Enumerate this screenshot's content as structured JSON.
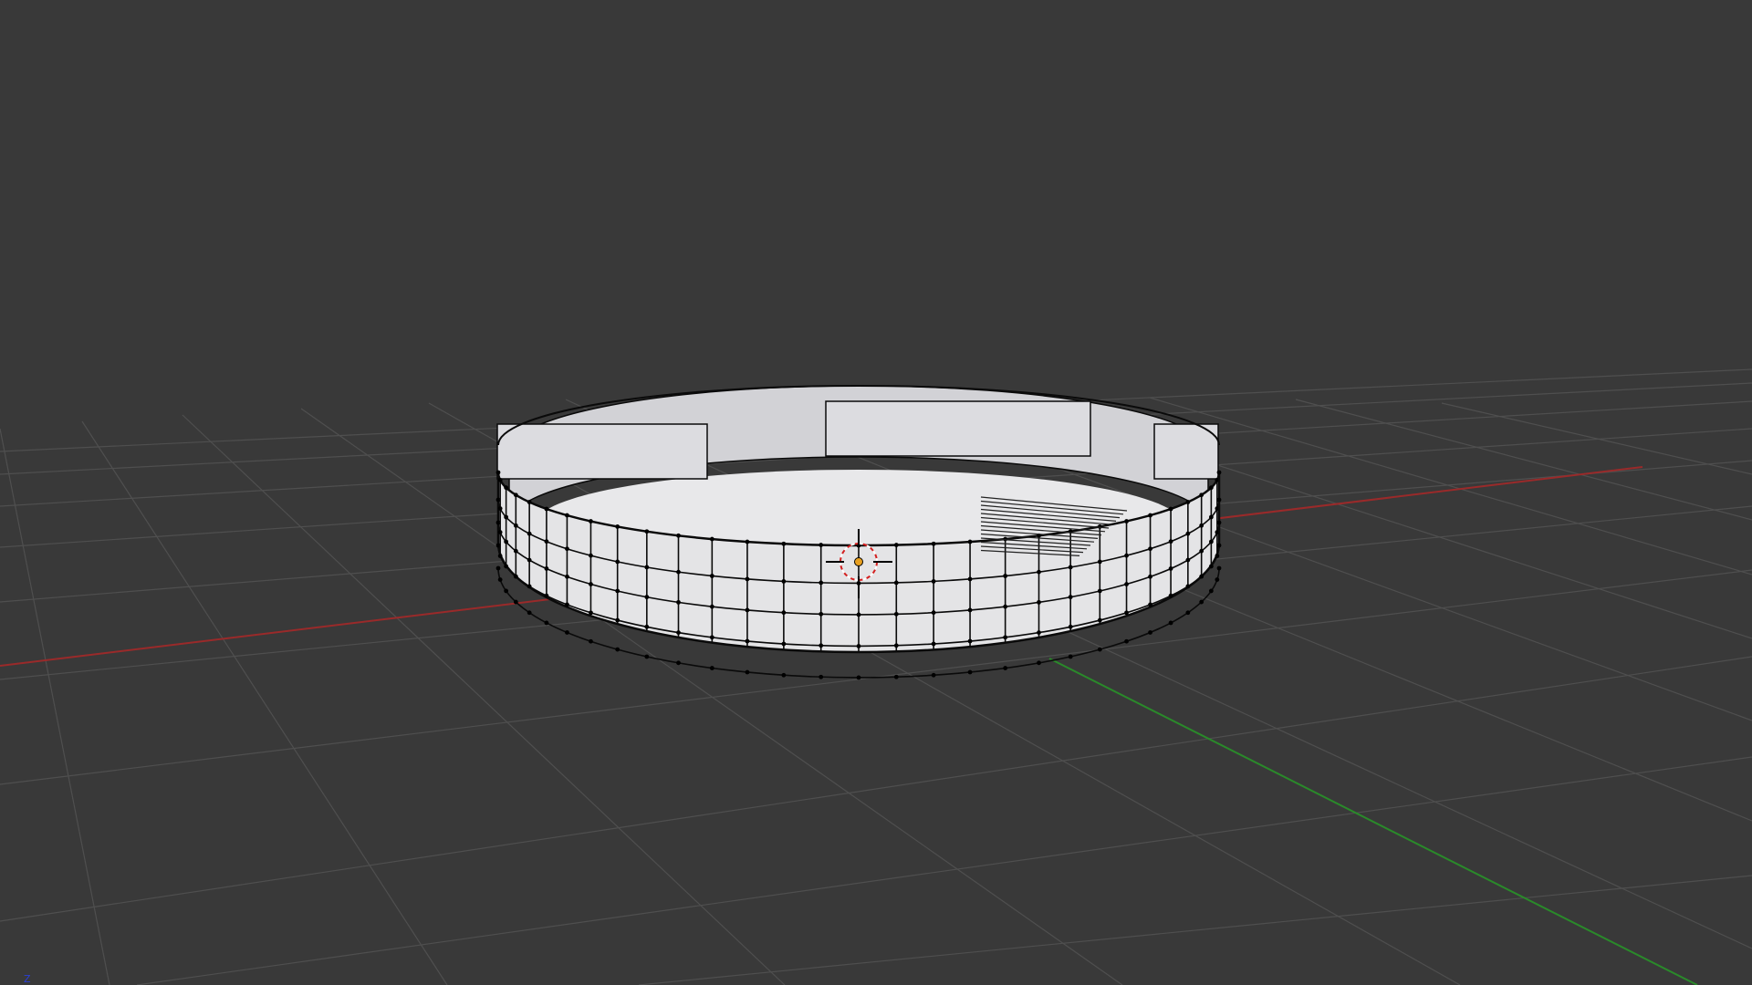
{
  "viewport": {
    "background": "#393939",
    "grid_color": "#4f4f4f",
    "x_axis_color": "#9a2a2a",
    "y_axis_color": "#2a8a2a",
    "mesh_face_color": "#e4e4e6",
    "mesh_edge_color": "#0a0a0a",
    "cursor_color": "#d42020"
  },
  "corner_axis": {
    "label": "Z",
    "color": "#2a3fd6"
  },
  "icons": {
    "cursor": "3d-cursor-icon",
    "origin": "object-origin-icon"
  }
}
